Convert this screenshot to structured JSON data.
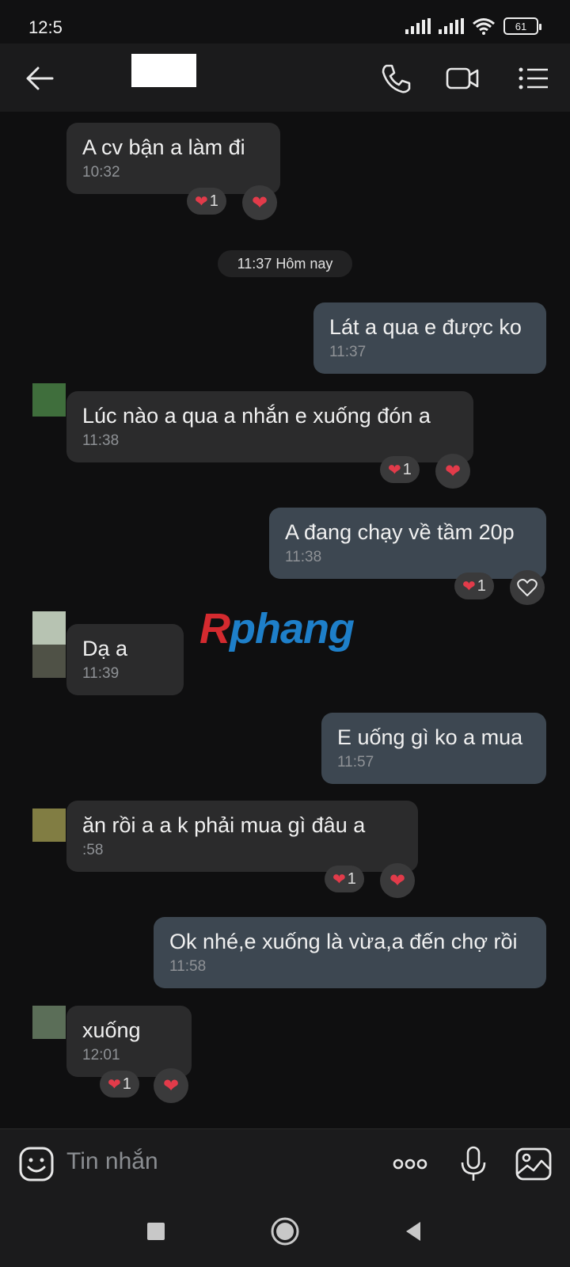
{
  "status": {
    "time": "12:5",
    "battery": "61"
  },
  "header": {
    "back_icon": "back-arrow-icon",
    "call_icon": "phone-icon",
    "video_icon": "video-camera-icon",
    "menu_icon": "list-menu-icon"
  },
  "chat": {
    "date_chip": "11:37 Hôm nay",
    "watermark": {
      "first": "R",
      "rest": "phang"
    },
    "messages": [
      {
        "dir": "in",
        "text": "A cv bận a làm đi",
        "time": "10:32",
        "reaction_count": "1"
      },
      {
        "dir": "out",
        "text": "Lát a qua e được ko",
        "time": "11:37"
      },
      {
        "dir": "in",
        "text": "Lúc nào a qua a nhắn e xuống đón a",
        "time": "11:38",
        "reaction_count": "1"
      },
      {
        "dir": "out",
        "text": "A đang chạy về tầm 20p",
        "time": "11:38",
        "reaction_count": "1"
      },
      {
        "dir": "in",
        "text": "Dạ a",
        "time": "11:39"
      },
      {
        "dir": "out",
        "text": "E uống gì ko a mua",
        "time": "11:57"
      },
      {
        "dir": "in",
        "text": "ăn rồi a a k phải mua gì đâu a",
        "time": ":58",
        "reaction_count": "1"
      },
      {
        "dir": "out",
        "text": "Ok nhé,e xuống là vừa,a đến chợ rồi",
        "time": "11:58"
      },
      {
        "dir": "in",
        "text": "xuống",
        "time": "12:01",
        "reaction_count": "1"
      }
    ]
  },
  "composer": {
    "placeholder": "Tin nhắn",
    "sticker_icon": "sticker-smile-icon",
    "more_icon": "more-dots-icon",
    "mic_icon": "microphone-icon",
    "image_icon": "image-gallery-icon"
  },
  "navbar": {
    "recent_icon": "square-recent-icon",
    "home_icon": "circle-home-icon",
    "back_icon": "triangle-back-icon"
  },
  "colors": {
    "incoming_bubble": "#2b2b2c",
    "outgoing_bubble": "#3d4751",
    "background": "#0f0f10",
    "heart": "#e23b4a"
  }
}
